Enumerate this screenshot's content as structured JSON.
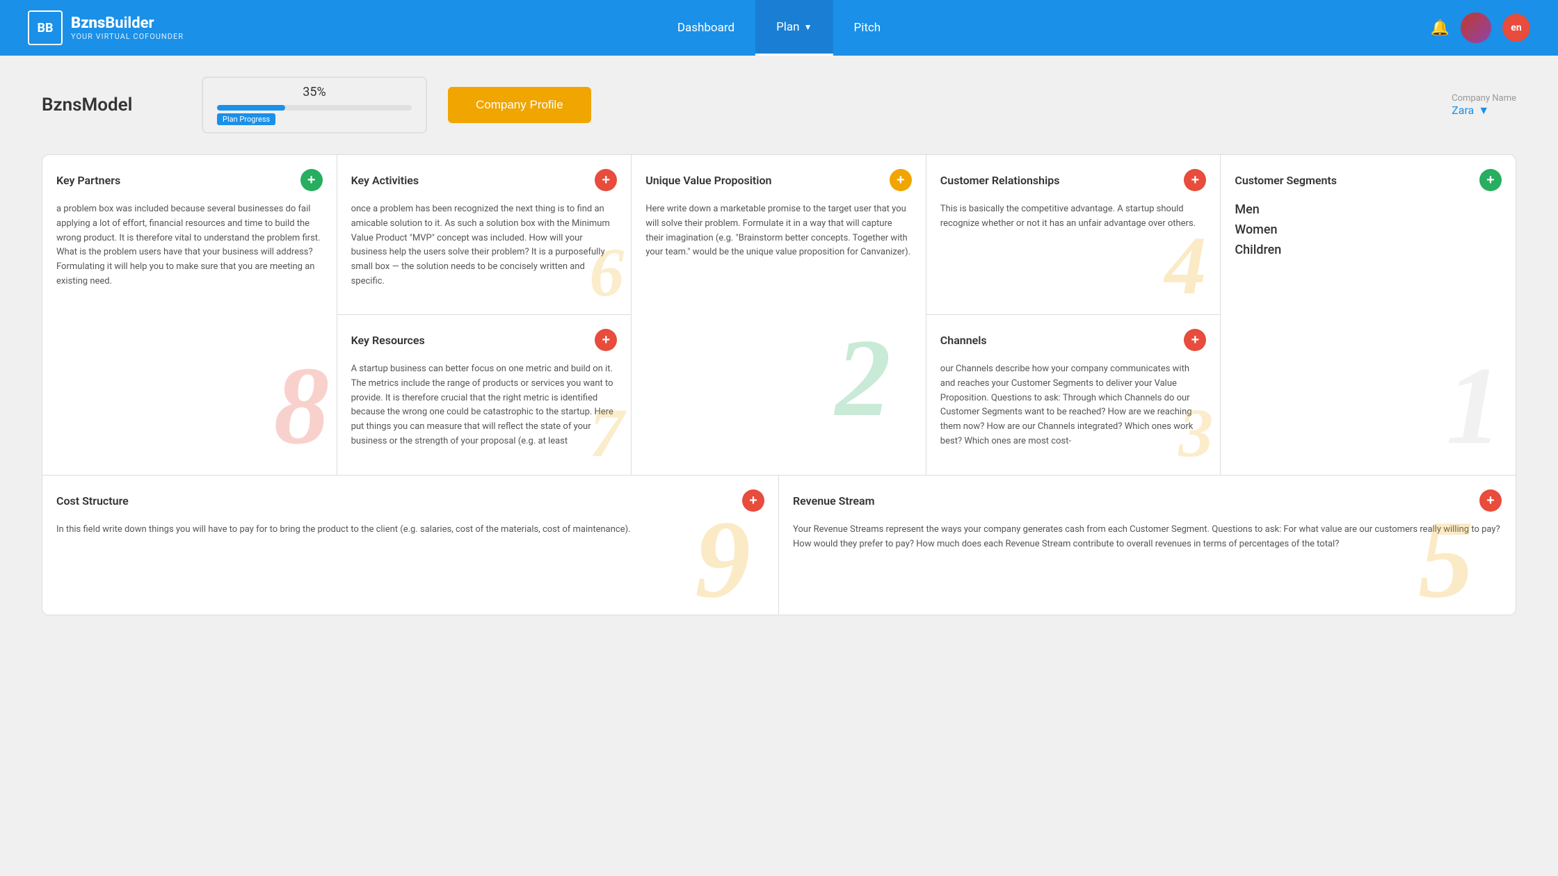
{
  "navbar": {
    "logo": "BB",
    "brand": "Bzns",
    "brand_part2": "Builder",
    "subtitle": "YOUR VIRTUAL COFOUNDER",
    "nav_items": [
      {
        "label": "Dashboard",
        "active": false
      },
      {
        "label": "Plan",
        "active": true,
        "has_arrow": true
      },
      {
        "label": "Pitch",
        "active": false
      }
    ],
    "lang": "en"
  },
  "header": {
    "title": "BznsModel",
    "progress_percent": "35%",
    "progress_label": "Plan Progress",
    "progress_fill": "35",
    "company_profile_btn": "Company Profile",
    "company_name_label": "Company Name",
    "company_name_value": "Zara"
  },
  "canvas": {
    "cells": {
      "key_partners": {
        "title": "Key Partners",
        "btn_color": "green",
        "text": "a problem box was included because several businesses do fail applying a lot of effort, financial resources and time to build the wrong product. It is therefore vital to understand the problem first. What is the problem users have that your business will address? Formulating it will help you to make sure that you are meeting an existing need.",
        "watermark": "8",
        "watermark_color": "color-red"
      },
      "key_activities": {
        "title": "Key Activities",
        "btn_color": "red",
        "text": "once a problem has been recognized the next thing is to find an amicable solution to it. As such a solution box with the Minimum Value Product \"MVP\" concept was included. How will your business help the users solve their problem? It is a purposefully small box — the solution needs to be concisely written and specific.",
        "watermark": "6",
        "watermark_color": "color-yellow"
      },
      "key_resources": {
        "title": "Key Resources",
        "btn_color": "red",
        "text": "A startup business can better focus on one metric and build on it. The metrics include the range of products or services you want to provide. It is therefore crucial that the right metric is identified because the wrong one could be catastrophic to the startup. Here put things you can measure that will reflect the state of your business or the strength of your proposal (e.g. at least",
        "watermark": "7",
        "watermark_color": "color-yellow"
      },
      "unique_value": {
        "title": "Unique Value Proposition",
        "btn_color": "yellow",
        "text": "Here write down a marketable promise to the target user that you will solve their problem. Formulate it in a way that will capture their imagination (e.g. \"Brainstorm better concepts. Together with your team.\" would be the unique value proposition for Canvanizer).",
        "watermark": "2",
        "watermark_color": "color-green"
      },
      "customer_relationships": {
        "title": "Customer Relationships",
        "btn_color": "pink",
        "text": "This is basically the competitive advantage. A startup should recognize whether or not it has an unfair advantage over others.",
        "watermark": "4",
        "watermark_color": "color-yellow"
      },
      "channels": {
        "title": "Channels",
        "btn_color": "pink",
        "text": "our Channels describe how your company communicates with and reaches your Customer Segments to deliver your Value Proposition. Questions to ask: Through which Channels do our Customer Segments want to be reached? How are we reaching them now? How are our Channels integrated? Which ones work best? Which ones are most cost-",
        "watermark": "3",
        "watermark_color": "color-yellow"
      },
      "customer_segments": {
        "title": "Customer Segments",
        "btn_color": "green",
        "items": [
          "Men",
          "Women",
          "Children"
        ],
        "watermark": "1",
        "watermark_color": "color-white"
      },
      "cost_structure": {
        "title": "Cost Structure",
        "btn_color": "pink",
        "text": "In this field write down things you will have to pay for to bring the product to the client (e.g. salaries, cost of the materials, cost of maintenance).",
        "watermark": "9",
        "watermark_color": "color-yellow"
      },
      "revenue_stream": {
        "title": "Revenue Stream",
        "btn_color": "pink",
        "text": "Your Revenue Streams represent the ways your company generates cash from each Customer Segment. Questions to ask: For what value are our customers really willing to pay? How would they prefer to pay? How much does each Revenue Stream contribute to overall revenues in terms of percentages of the total?",
        "watermark": "5",
        "watermark_color": "color-yellow"
      }
    }
  }
}
